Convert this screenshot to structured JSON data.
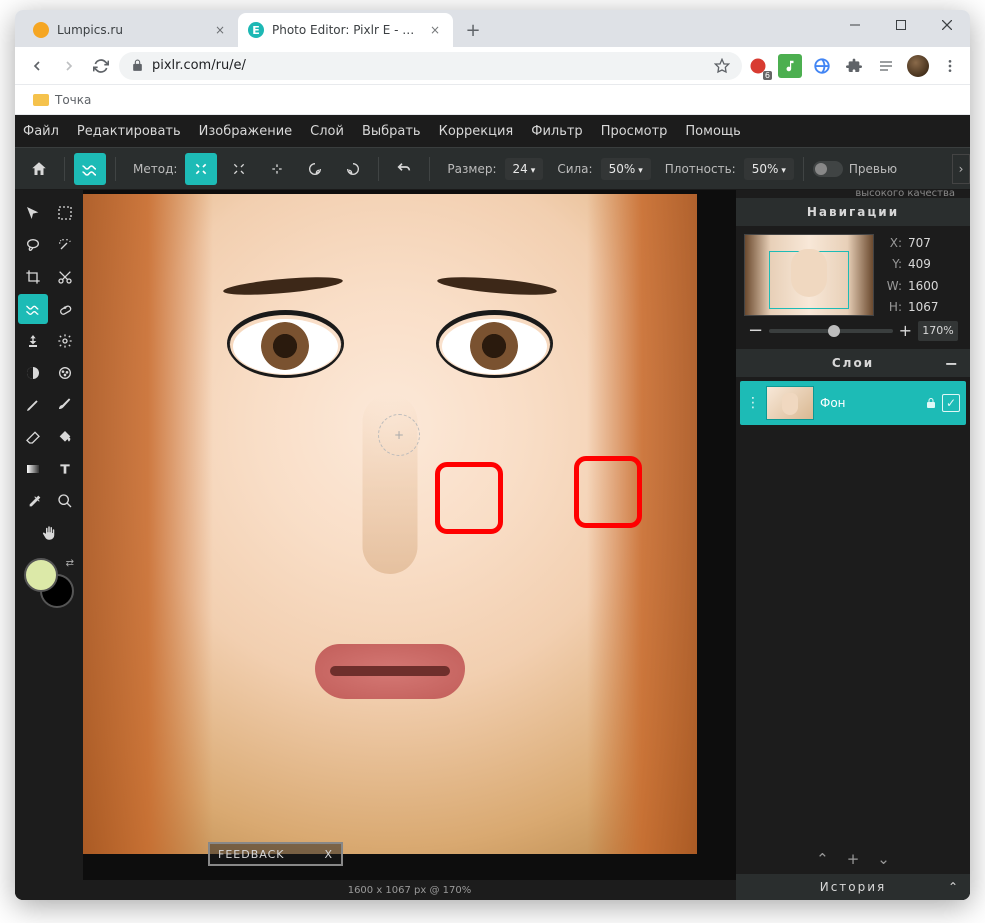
{
  "browser": {
    "tabs": [
      {
        "title": "Lumpics.ru",
        "favicon_color": "#f5a623",
        "active": false
      },
      {
        "title": "Photo Editor: Pixlr E - бесплатн",
        "favicon_color": "#1db8b4",
        "favicon_letter": "E",
        "active": true
      }
    ],
    "url": "pixlr.com/ru/e/",
    "bookmark": "Точка"
  },
  "pixlr": {
    "menu": [
      "Файл",
      "Редактировать",
      "Изображение",
      "Слой",
      "Выбрать",
      "Коррекция",
      "Фильтр",
      "Просмотр",
      "Помощь"
    ],
    "toolbar": {
      "method_label": "Метод:",
      "size_label": "Размер:",
      "size_value": "24",
      "strength_label": "Сила:",
      "strength_value": "50%",
      "density_label": "Плотность:",
      "density_value": "50%",
      "preview_label": "Превью"
    },
    "nav_panel": {
      "title": "Навигации",
      "banner": "высокого качества",
      "x_label": "X:",
      "x": "707",
      "y_label": "Y:",
      "y": "409",
      "w_label": "W:",
      "w": "1600",
      "h_label": "H:",
      "h": "1067",
      "zoom": "170%"
    },
    "layers_panel": {
      "title": "Слои",
      "layer_name": "Фон"
    },
    "history_panel": {
      "title": "История"
    },
    "feedback": {
      "label": "FEEDBACK",
      "close": "X"
    },
    "status": "1600 x 1067 px @ 170%"
  }
}
